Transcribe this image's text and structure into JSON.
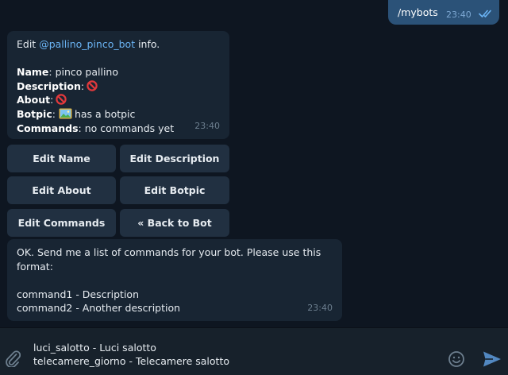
{
  "outgoing": {
    "text": "/mybots",
    "time": "23:40"
  },
  "bot_info": {
    "intro_prefix": "Edit ",
    "bot_handle": "@pallino_pinco_bot",
    "intro_suffix": " info.",
    "name_label": "Name",
    "name_value": ": pinco pallino",
    "description_label": "Description",
    "description_sep": ":",
    "about_label": "About",
    "about_sep": ":",
    "botpic_label": "Botpic",
    "botpic_sep": ":",
    "botpic_value": "has a botpic",
    "commands_label": "Commands",
    "commands_value": ": no commands yet",
    "time": "23:40"
  },
  "keyboard": {
    "edit_name": "Edit Name",
    "edit_description": "Edit Description",
    "edit_about": "Edit About",
    "edit_botpic": "Edit Botpic",
    "edit_commands": "Edit Commands",
    "back_to_bot": "« Back to Bot"
  },
  "reply": {
    "line1": "OK. Send me a list of commands for your bot. Please use this",
    "line2": "format:",
    "line3": "command1 - Description",
    "line4": "command2 - Another description",
    "time": "23:40"
  },
  "composer": {
    "line1": "luci_salotto - Luci salotto",
    "line2": "telecamere_giorno - Telecamere salotto"
  },
  "icons": {
    "read_receipt": "double-check-icon",
    "empty_value": "no-entry-icon",
    "picture": "picture-icon",
    "attach": "paperclip-icon",
    "emoji": "smiley-icon",
    "send": "send-arrow-icon"
  },
  "colors": {
    "background": "#0e1621",
    "outgoing_bubble": "#2b5278",
    "incoming_bubble": "#182533",
    "keyboard_button": "#213041",
    "link": "#6ab3f3",
    "accent": "#5288c1"
  }
}
